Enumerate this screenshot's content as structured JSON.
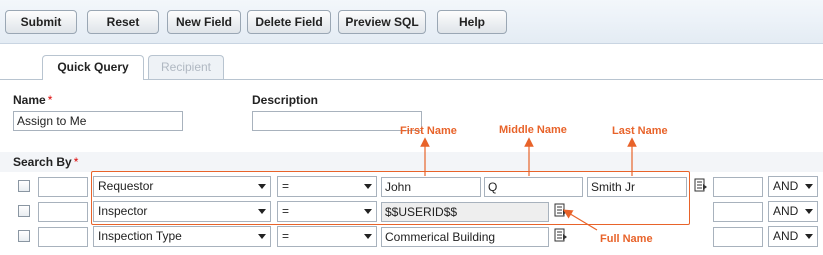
{
  "toolbar": {
    "submit": "Submit",
    "reset": "Reset",
    "new_field": "New Field",
    "delete_field": "Delete Field",
    "preview_sql": "Preview SQL",
    "help": "Help"
  },
  "tabs": [
    {
      "label": "Quick Query",
      "active": true
    },
    {
      "label": "Recipient",
      "active": false
    }
  ],
  "form": {
    "name_label": "Name",
    "name_value": "Assign to Me",
    "description_label": "Description",
    "description_value": "",
    "search_by_label": "Search By",
    "required_mark": "*"
  },
  "rows": [
    {
      "field": "Requestor",
      "operator": "=",
      "values": [
        "John",
        "Q",
        "Smith Jr"
      ],
      "conjunction": "AND"
    },
    {
      "field": "Inspector",
      "operator": "=",
      "values": [
        "$$USERID$$"
      ],
      "conjunction": "AND"
    },
    {
      "field": "Inspection Type",
      "operator": "=",
      "values": [
        "Commerical Building"
      ],
      "conjunction": "AND"
    }
  ],
  "annotations": {
    "first_name": "First Name",
    "middle_name": "Middle Name",
    "last_name": "Last Name",
    "full_name": "Full Name",
    "color": "#e8632a"
  },
  "icons": {
    "picker": "field-picker-icon",
    "dropdown": "chevron-down-icon"
  }
}
